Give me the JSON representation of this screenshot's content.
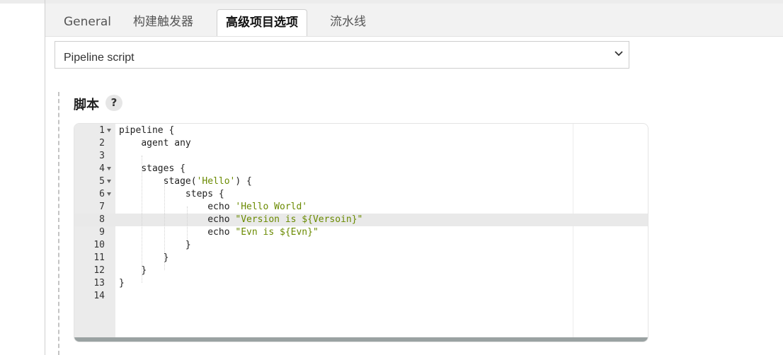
{
  "tabs": [
    {
      "label": "General"
    },
    {
      "label": "构建触发器"
    },
    {
      "label": "高级项目选项"
    },
    {
      "label": "流水线"
    }
  ],
  "definition": {
    "selected": "Pipeline script"
  },
  "section": {
    "label": "脚本",
    "help": "?"
  },
  "code_lines": [
    {
      "num": "1",
      "fold": true,
      "indent": "",
      "pre": "pipeline {",
      "str": "",
      "post": ""
    },
    {
      "num": "2",
      "fold": false,
      "indent": "    ",
      "pre": "agent any",
      "str": "",
      "post": ""
    },
    {
      "num": "3",
      "fold": false,
      "indent": "",
      "pre": "",
      "str": "",
      "post": ""
    },
    {
      "num": "4",
      "fold": true,
      "indent": "    ",
      "pre": "stages {",
      "str": "",
      "post": ""
    },
    {
      "num": "5",
      "fold": true,
      "indent": "        ",
      "pre": "stage(",
      "str": "'Hello'",
      "post": ") {"
    },
    {
      "num": "6",
      "fold": true,
      "indent": "            ",
      "pre": "steps {",
      "str": "",
      "post": ""
    },
    {
      "num": "7",
      "fold": false,
      "indent": "                ",
      "pre": "echo ",
      "str": "'Hello World'",
      "post": ""
    },
    {
      "num": "8",
      "fold": false,
      "indent": "                ",
      "pre": "echo ",
      "str": "\"Version is ${Versoin}\"",
      "post": ""
    },
    {
      "num": "9",
      "fold": false,
      "indent": "                ",
      "pre": "echo ",
      "str": "\"Evn is ${Evn}\"",
      "post": ""
    },
    {
      "num": "10",
      "fold": false,
      "indent": "            ",
      "pre": "}",
      "str": "",
      "post": ""
    },
    {
      "num": "11",
      "fold": false,
      "indent": "        ",
      "pre": "}",
      "str": "",
      "post": ""
    },
    {
      "num": "12",
      "fold": false,
      "indent": "    ",
      "pre": "}",
      "str": "",
      "post": ""
    },
    {
      "num": "13",
      "fold": false,
      "indent": "",
      "pre": "}",
      "str": "",
      "post": ""
    },
    {
      "num": "14",
      "fold": false,
      "indent": "",
      "pre": "",
      "str": "",
      "post": ""
    }
  ],
  "active_line": "8",
  "colors": {
    "string": "#6a8a00",
    "gutter": "#ebebeb",
    "active_line": "#e9e9e9"
  }
}
